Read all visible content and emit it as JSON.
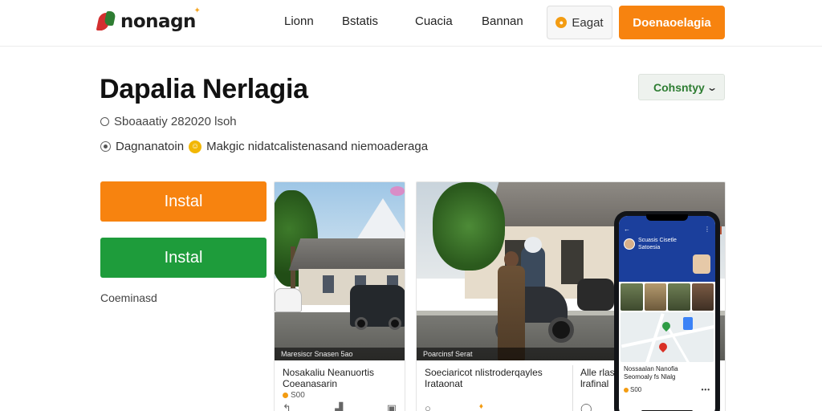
{
  "header": {
    "logo_text": "nonagn",
    "nav": [
      "Lionn",
      "Bstatis",
      "Cuacia",
      "Bannan"
    ],
    "login_label": "Eagat",
    "download_label": "Doenaoelagia"
  },
  "app": {
    "title": "Dapalia Nerlagia",
    "country_select": "Cohsntyy",
    "meta": "Sboaaatiy 282020 lsoh",
    "developer": "Dagnanatoin",
    "developer_desc": "Makgic nidatcalistenasand niemoaderaga"
  },
  "actions": {
    "install_orange": "Instal",
    "install_green": "Instal",
    "comments": "Coeminasd"
  },
  "screenshots": {
    "card1": {
      "caption": "Maresiscr Snasen 5ao",
      "title": "Nosakaliu Neanuortis",
      "subtitle": "Coeanasarin",
      "meta": "S00"
    },
    "card2": {
      "caption": "Poarcinsf Serat",
      "title": "Soeciaricot nlistroderqayles",
      "subtitle": "Irataonat",
      "side_title": "Alle rlas",
      "side_subtitle": "lrafinal"
    },
    "phone": {
      "header_label": "Scuasis Cisetle",
      "header_sub": "Satoesia",
      "caption_line1": "Nossaalan Nanofia",
      "caption_line2": "Seomoaly fs Nlalg",
      "footer_meta": "S00",
      "footer_dots": "•••"
    }
  },
  "colors": {
    "orange": "#f7830f",
    "green": "#1e9c3b",
    "phone_header": "#1b3f9c"
  },
  "icons": [
    "coin-icon",
    "chevron-down-icon",
    "clock-icon",
    "radio-icon",
    "badge-icon",
    "pin-icon",
    "share-icon",
    "bookmark-icon",
    "comment-icon"
  ]
}
